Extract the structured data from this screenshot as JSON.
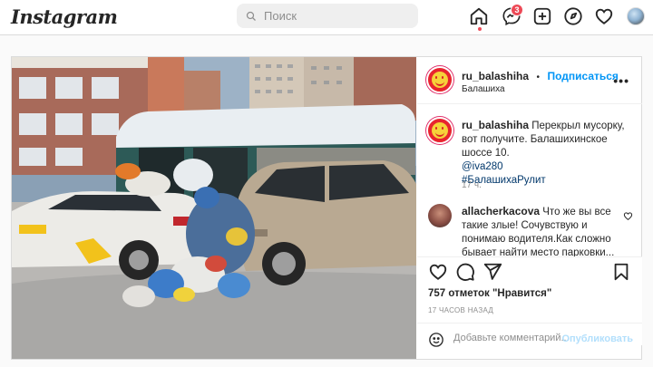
{
  "nav": {
    "logo": "Instagram",
    "search_placeholder": "Поиск",
    "notification_count": "3",
    "icons": [
      "home-icon",
      "messenger-icon",
      "new-post-icon",
      "explore-icon",
      "heart-icon",
      "profile-avatar"
    ],
    "accent": "#ed4956"
  },
  "post": {
    "username": "ru_balashiha",
    "follow_label": "Подписаться",
    "separator": "•",
    "location": "Балашиха",
    "more": "•••",
    "caption": {
      "username": "ru_balashiha",
      "text": "Перекрыл мусорку, вот получите. Балашихинское шоссе 10.",
      "mention": "@iva280",
      "hashtag": "#БалашихаРулит"
    },
    "caption_age": "17 ч.",
    "comment": {
      "username": "allacherkacova",
      "text": "Что же вы все такие злые! Сочувствую и понимаю водителя.Как сложно бывает найти место парковки..."
    },
    "likes": "757 отметок \"Нравится\"",
    "time_ago": "17 ЧАСОВ НАЗАД",
    "comment_placeholder": "Добавьте комментарий...",
    "publish_label": "Опубликовать",
    "link_color": "#00376b",
    "follow_color": "#0095f6"
  }
}
